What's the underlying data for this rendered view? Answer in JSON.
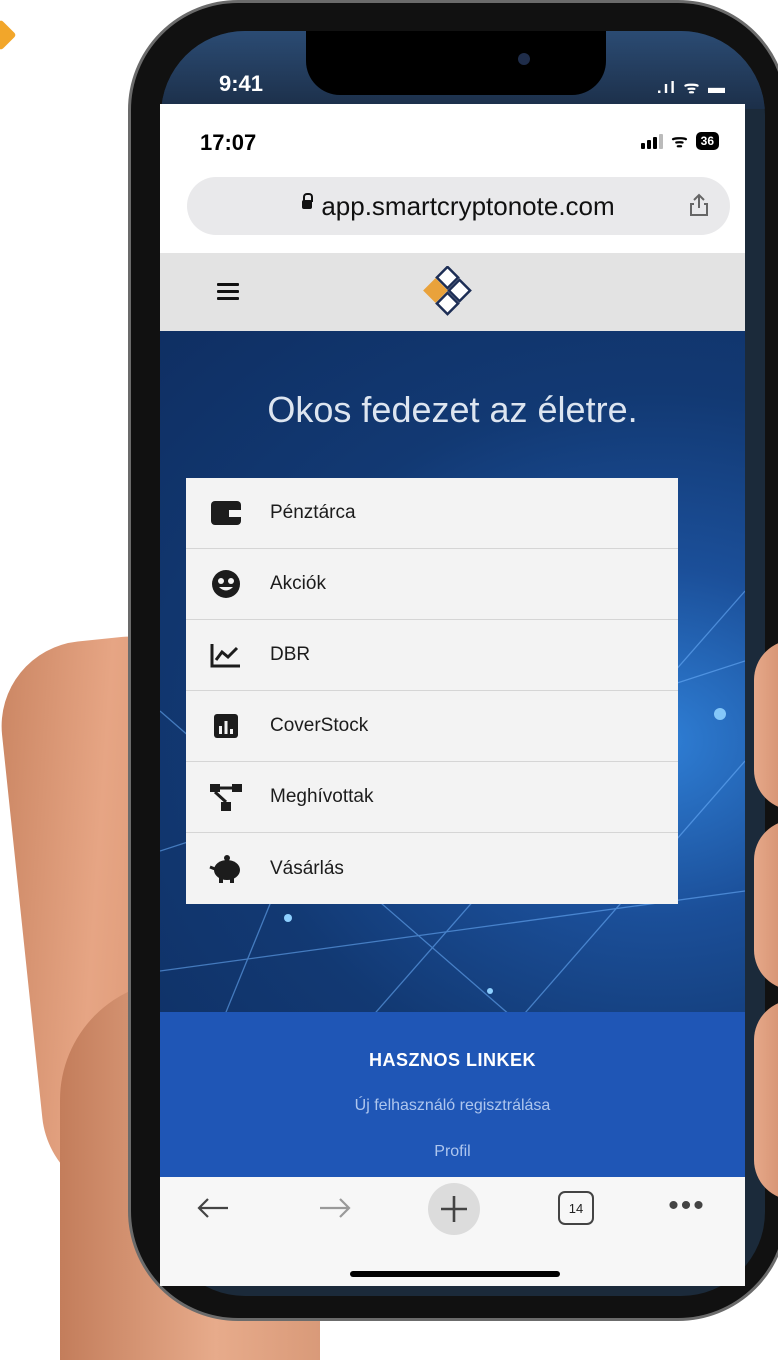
{
  "outer_status": {
    "time": "9:41",
    "icons": ".ıl ᯤ ▬"
  },
  "status_bar": {
    "time": "17:07",
    "battery": "36"
  },
  "browser": {
    "url": "app.smartcryptonote.com"
  },
  "hero": {
    "headline": "Okos fedezet az életre."
  },
  "menu": {
    "items": [
      {
        "label": "Pénztárca",
        "icon": "wallet-icon"
      },
      {
        "label": "Akciók",
        "icon": "star-struck-face-icon"
      },
      {
        "label": "DBR",
        "icon": "chart-line-icon"
      },
      {
        "label": "CoverStock",
        "icon": "bar-chart-icon"
      },
      {
        "label": "Meghívottak",
        "icon": "network-tree-icon"
      },
      {
        "label": "Vásárlás",
        "icon": "piggy-bank-icon"
      }
    ]
  },
  "footer": {
    "title": "HASZNOS LINKEK",
    "links": [
      "Új felhasználó regisztrálása",
      "Profil"
    ]
  },
  "toolbar": {
    "tabs_count": "14",
    "more": "•••"
  },
  "colors": {
    "brand": "#123973",
    "accent": "#e9a23b",
    "footer": "#1f56b6"
  }
}
